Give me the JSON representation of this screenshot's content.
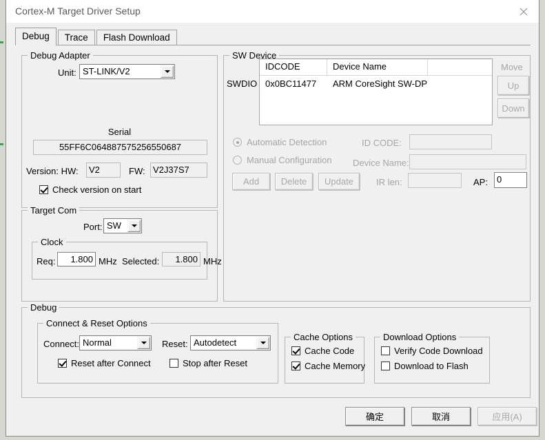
{
  "window": {
    "title": "Cortex-M Target Driver Setup",
    "close_icon": "close-icon"
  },
  "tabs": [
    {
      "label": "Debug",
      "active": true
    },
    {
      "label": "Trace",
      "active": false
    },
    {
      "label": "Flash Download",
      "active": false
    }
  ],
  "debug_adapter": {
    "legend": "Debug Adapter",
    "unit_label": "Unit:",
    "unit_value": "ST-LINK/V2",
    "serial_label": "Serial",
    "serial_value": "55FF6C064887575256550687",
    "version_label": "Version: HW:",
    "hw_value": "V2",
    "fw_label": "FW:",
    "fw_value": "V2J37S7",
    "check_version_label": "Check version on start",
    "check_version_checked": true
  },
  "sw_device": {
    "legend": "SW Device",
    "swdio_label": "SWDIO",
    "columns": [
      "IDCODE",
      "Device Name",
      ""
    ],
    "rows": [
      {
        "idcode": "0x0BC11477",
        "device_name": "ARM CoreSight SW-DP"
      }
    ],
    "move_label": "Move",
    "up_label": "Up",
    "down_label": "Down",
    "automatic_detection_label": "Automatic Detection",
    "automatic_detection_selected": true,
    "manual_configuration_label": "Manual Configuration",
    "manual_configuration_selected": false,
    "id_code_label": "ID CODE:",
    "id_code_value": "",
    "device_name_label": "Device Name:",
    "device_name_value": "",
    "ir_len_label": "IR len:",
    "ir_len_value": "",
    "ap_label": "AP:",
    "ap_value": "0",
    "add_label": "Add",
    "delete_label": "Delete",
    "update_label": "Update"
  },
  "target_com": {
    "legend": "Target Com",
    "port_label": "Port:",
    "port_value": "SW",
    "clock_legend": "Clock",
    "req_label": "Req:",
    "req_value": "1.800",
    "req_unit": "MHz",
    "selected_label": "Selected:",
    "selected_value": "1.800",
    "selected_unit": "MHz"
  },
  "debug_panel": {
    "legend": "Debug",
    "connect_reset": {
      "legend": "Connect & Reset Options",
      "connect_label": "Connect:",
      "connect_value": "Normal",
      "reset_label": "Reset:",
      "reset_value": "Autodetect",
      "reset_after_connect_label": "Reset after Connect",
      "reset_after_connect_checked": true,
      "stop_after_reset_label": "Stop after Reset",
      "stop_after_reset_checked": false
    },
    "cache": {
      "legend": "Cache Options",
      "cache_code_label": "Cache Code",
      "cache_code_checked": true,
      "cache_memory_label": "Cache Memory",
      "cache_memory_checked": true
    },
    "download": {
      "legend": "Download Options",
      "verify_code_download_label": "Verify Code Download",
      "verify_code_download_checked": false,
      "download_to_flash_label": "Download to Flash",
      "download_to_flash_checked": false
    }
  },
  "footer": {
    "ok_label": "确定",
    "cancel_label": "取消",
    "apply_label": "应用(A)"
  }
}
